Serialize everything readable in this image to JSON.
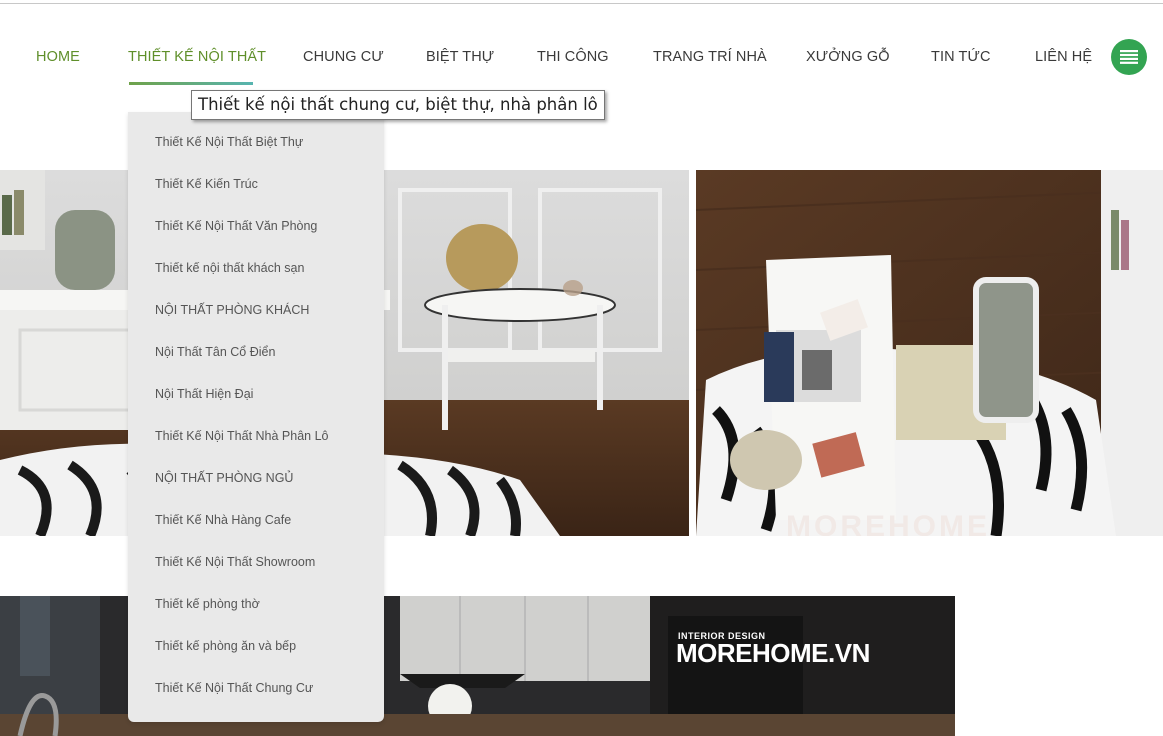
{
  "nav": {
    "items": [
      {
        "label": "HOME"
      },
      {
        "label": "THIẾT KẾ NỘI THẤT"
      },
      {
        "label": "CHUNG CƯ"
      },
      {
        "label": "BIỆT THỰ"
      },
      {
        "label": "THI CÔNG"
      },
      {
        "label": "TRANG TRÍ NHÀ"
      },
      {
        "label": "XƯỞNG GỖ"
      },
      {
        "label": "TIN TỨC"
      },
      {
        "label": "LIÊN HỆ"
      }
    ],
    "active_index": 1,
    "menu_icon": "list-menu-icon"
  },
  "tooltip": {
    "text": "Thiết kế nội thất chung cư, biệt thự, nhà phân lô"
  },
  "dropdown": {
    "items": [
      {
        "label": "Thiết Kế Nội Thất Biệt Thự"
      },
      {
        "label": "Thiết Kế Kiến Trúc"
      },
      {
        "label": "Thiết Kế Nội Thất Văn Phòng"
      },
      {
        "label": "Thiết kế nội thất khách sạn"
      },
      {
        "label": "NỘI THẤT PHÒNG KHÁCH"
      },
      {
        "label": "Nội Thất Tân Cổ Điển"
      },
      {
        "label": "Nội Thất Hiện Đại"
      },
      {
        "label": "Thiết Kế Nội Thất Nhà Phân Lô"
      },
      {
        "label": "NỘI THẤT PHÒNG NGỦ"
      },
      {
        "label": "Thiết Kế Nhà Hàng Cafe"
      },
      {
        "label": "Thiết Kế Nội Thất Showroom"
      },
      {
        "label": "Thiết kế phòng thờ"
      },
      {
        "label": "Thiết kế phòng ăn và bếp"
      },
      {
        "label": "Thiết Kế Nội Thất Chung Cư"
      }
    ]
  },
  "banner": {
    "watermark": "MOREHOME",
    "brand_small": "INTERIOR DESIGN",
    "brand_large": "MOREHOME.VN"
  },
  "colors": {
    "accent_green": "#5f8f2a",
    "menu_button": "#33a452",
    "dropdown_bg": "#e9e9e9"
  }
}
